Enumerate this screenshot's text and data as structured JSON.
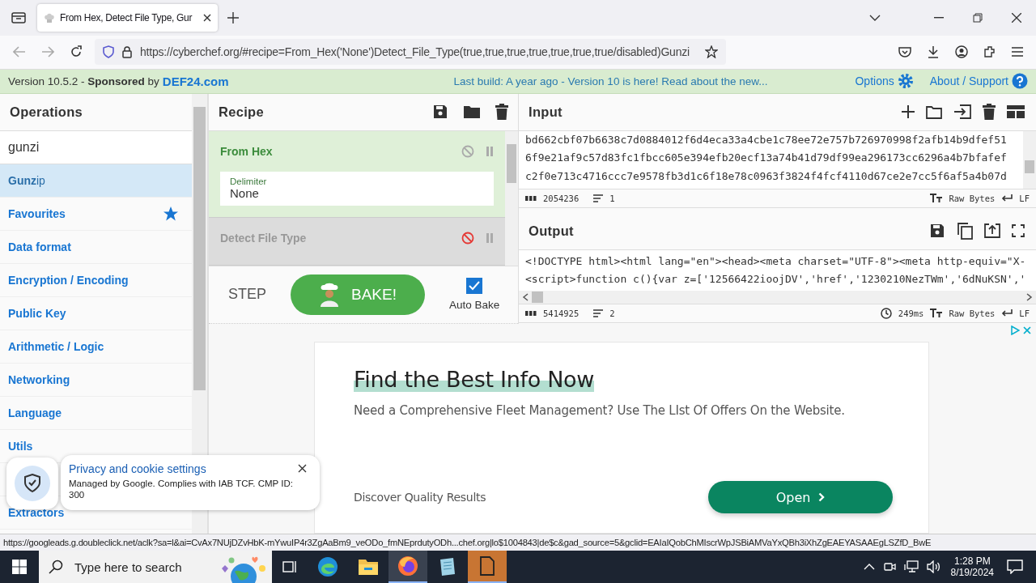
{
  "browser": {
    "tab_title": "From Hex, Detect File Type, Gur",
    "url": "https://cyberchef.org/#recipe=From_Hex('None')Detect_File_Type(true,true,true,true,true,true,true/disabled)Gunzi"
  },
  "banner": {
    "version": "Version 10.5.2 - **Sponsored** by",
    "sponsor": "DEF24.com",
    "notice": "Last build: A year ago - Version 10 is here! Read about the new...",
    "options": "Options",
    "about": "About / Support"
  },
  "operations": {
    "title": "Operations",
    "search": "gunzi",
    "items": [
      {
        "label": "**Gunz**ip",
        "kind": "result",
        "selected": true
      },
      {
        "label": "Favourites",
        "kind": "favourites",
        "selected": false
      },
      {
        "label": "Data format",
        "kind": "category",
        "selected": false
      },
      {
        "label": "Encryption / Encoding",
        "kind": "category",
        "selected": false
      },
      {
        "label": "Public Key",
        "kind": "category",
        "selected": false
      },
      {
        "label": "Arithmetic / Logic",
        "kind": "category",
        "selected": false
      },
      {
        "label": "Networking",
        "kind": "category",
        "selected": false
      },
      {
        "label": "Language",
        "kind": "category",
        "selected": false
      },
      {
        "label": "Utils",
        "kind": "category",
        "selected": false
      },
      {
        "label": "Extractors",
        "kind": "category",
        "selected": false
      }
    ]
  },
  "recipe": {
    "title": "Recipe",
    "steps": [
      {
        "name": "From Hex",
        "disabled": false,
        "args": [
          {
            "label": "Delimiter",
            "value": "None"
          }
        ]
      },
      {
        "name": "Detect File Type",
        "disabled": true
      }
    ],
    "step": "STEP",
    "bake": "BAKE!",
    "auto_bake": {
      "label": "Auto Bake",
      "checked": true
    }
  },
  "input": {
    "title": "Input",
    "lines": [
      "bd662cbf07b6638c7d0884012f6d4eca33a4cbe1c78ee72e757b726970998f2afb14b9dfef51",
      "6f9e21af9c57d83fc1fbcc605e394efb20ecf13a74b41d79df99ea296173cc6296a4b7bfafef",
      "c2f0e713c4716ccc7e9578fb3d1c6f18e78c0963f3824f4fcf4110d67ce2e7cc5f6af5a4b07d"
    ],
    "length": "2054236",
    "line_count": "1",
    "encoding": "Raw Bytes",
    "eol": "LF"
  },
  "output": {
    "title": "Output",
    "lines": [
      "<!DOCTYPE html><html lang=\"en\"><head><meta charset=\"UTF-8\"><meta http-equiv=\"X-",
      "<script>function c(){var z=['12566422ioojDV','href','1230210NezTWm','6dNuKSN','"
    ],
    "length": "5414925",
    "line_count": "2",
    "time": "249ms",
    "encoding": "Raw Bytes",
    "eol": "LF"
  },
  "ad": {
    "headline": "Find the Best Info Now",
    "body": "Need a Comprehensive Fleet Management? Use The LIst Of Offers On the Website.",
    "footer": "Discover Quality Results",
    "button": "Open"
  },
  "cookie_popup": {
    "title": "Privacy and cookie settings",
    "text": "Managed by Google. Complies with IAB TCF. CMP ID: 300"
  },
  "status_url": "https://googleads.g.doubleclick.net/aclk?sa=l&ai=CvAx7NUjDZvHbK-mYwuIP4r3ZgAaBm9_veODo_fmNEprdutyODh...chef.org|lo$1004843|de$c&gad_source=5&gclid=EAIaIQobChMIscrWpJSBiAMVaYxQBh3iXhZgEAEYASAAEgLSZfD_BwE",
  "taskbar": {
    "search_placeholder": "Type here to search",
    "time": "1:28 PM",
    "date": "8/19/2024"
  }
}
